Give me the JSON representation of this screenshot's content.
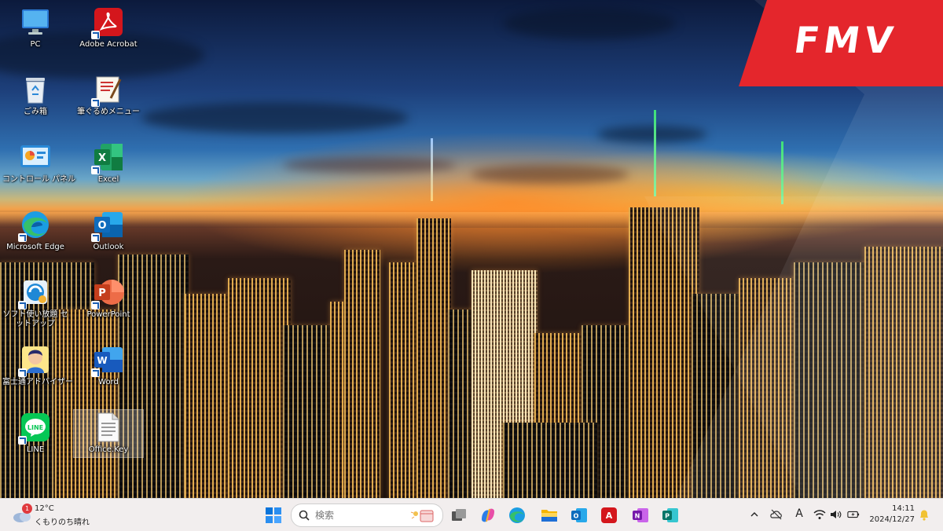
{
  "wallpaper": {
    "brand_logo_text": "FMV"
  },
  "desktop_icons": [
    {
      "label": "PC"
    },
    {
      "label": "Adobe Acrobat"
    },
    {
      "label": "ごみ箱"
    },
    {
      "label": "筆ぐるめメニュー"
    },
    {
      "label": "コントロール パネル"
    },
    {
      "label": "Excel"
    },
    {
      "label": "Microsoft Edge"
    },
    {
      "label": "Outlook"
    },
    {
      "label": "ソフト使い放題 セットアップ"
    },
    {
      "label": "PowerPoint"
    },
    {
      "label": "富士通アドバイザー"
    },
    {
      "label": "Word"
    },
    {
      "label": "LINE"
    },
    {
      "label": "Office.Key"
    }
  ],
  "taskbar": {
    "weather": {
      "badge_count": "1",
      "temperature": "12°C",
      "condition": "くもりのち晴れ"
    },
    "search": {
      "placeholder": "検索"
    },
    "pinned_apps": [
      "start-icon",
      "task-view-icon",
      "copilot-icon",
      "edge-icon",
      "file-explorer-icon",
      "outlook-icon",
      "acrobat-icon",
      "onenote-icon",
      "publisher-icon"
    ],
    "tray": {
      "ime_mode": "A",
      "time": "14:11",
      "date": "2024/12/27"
    }
  },
  "colors": {
    "brand_red": "#e4262c",
    "taskbar_bg": "#f2eeee",
    "accent_blue": "#0078d4"
  }
}
